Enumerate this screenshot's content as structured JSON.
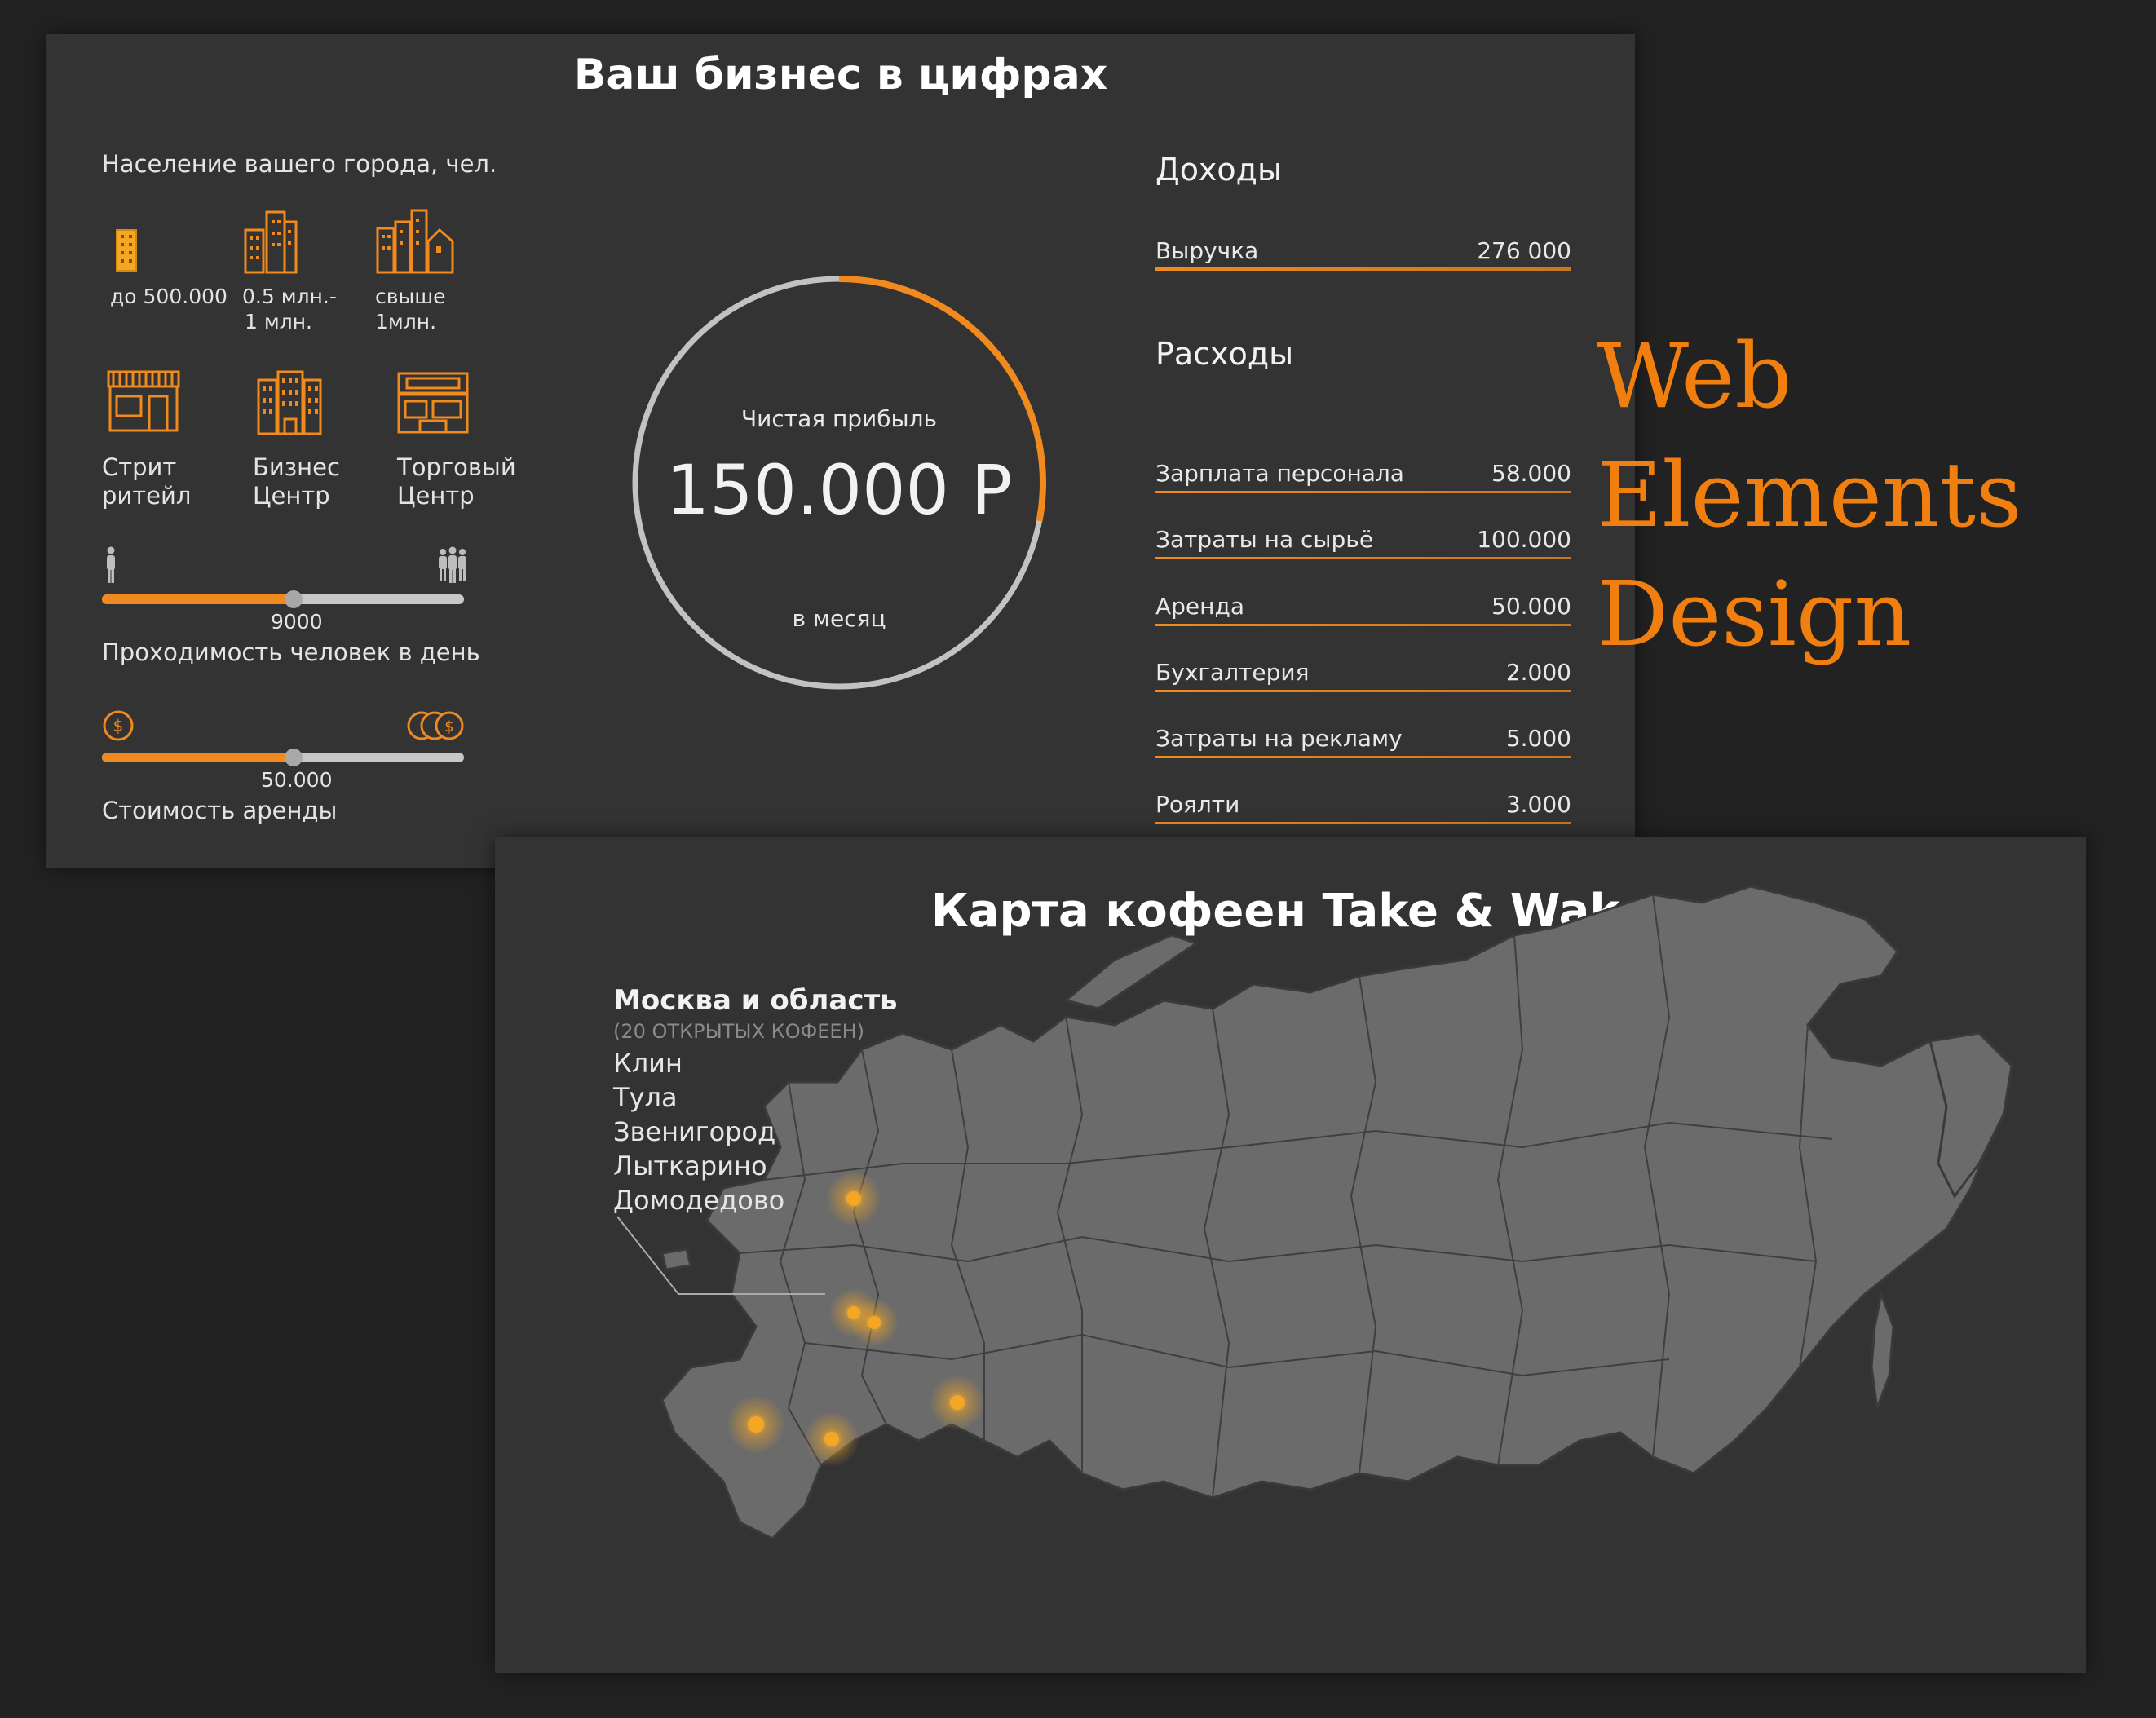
{
  "calculator": {
    "title": "Ваш бизнес в цифрах",
    "population_label": "Население вашего города, чел.",
    "population_options": [
      {
        "icon": "single-building-icon",
        "label_l1": "до 500.000",
        "label_l2": ""
      },
      {
        "icon": "buildings-icon",
        "label_l1": "0.5 млн.-",
        "label_l2": "1 млн."
      },
      {
        "icon": "city-icon",
        "label_l1": "свыше",
        "label_l2": "1млн."
      }
    ],
    "location_options": [
      {
        "icon": "storefront-icon",
        "label_l1": "Стрит",
        "label_l2": "ритейл"
      },
      {
        "icon": "office-building-icon",
        "label_l1": "Бизнес",
        "label_l2": "Центр"
      },
      {
        "icon": "mall-icon",
        "label_l1": "Торговый",
        "label_l2": "Центр"
      }
    ],
    "traffic": {
      "value": "9000",
      "label": "Проходимость человек  в день",
      "fraction": 0.53
    },
    "rent": {
      "value": "50.000",
      "label": "Стоимость аренды",
      "fraction": 0.53
    },
    "profit": {
      "caption": "Чистая прибыль",
      "amount": "150.000 Р",
      "period": "в месяц",
      "fraction": 0.28
    },
    "income": {
      "heading": "Доходы",
      "items": [
        {
          "name": "Выручка",
          "value": "276 000"
        }
      ]
    },
    "expenses": {
      "heading": "Расходы",
      "items": [
        {
          "name": "Зарплата персонала",
          "value": "58.000"
        },
        {
          "name": "Затраты на сырьё",
          "value": "100.000"
        },
        {
          "name": "Аренда",
          "value": "50.000"
        },
        {
          "name": "Бухгалтерия",
          "value": "2.000"
        },
        {
          "name": "Затраты на рекламу",
          "value": "5.000"
        },
        {
          "name": "Роялти",
          "value": "3.000"
        }
      ]
    },
    "colors": {
      "accent": "#f08a1e",
      "panel": "#333333",
      "track": "#c7c7c7"
    }
  },
  "overlay_text": {
    "line1": "Web",
    "line2": "Elements",
    "line3": "Design",
    "color": "#f07f10"
  },
  "map": {
    "title": "Карта кофеен Take & Wake",
    "region": "Москва и область",
    "count": "(20 ОТКРЫТЫХ КОФЕЕН)",
    "cities": [
      "Клин",
      "Тула",
      "Звенигород",
      "Лыткарино",
      "Домодедово"
    ],
    "marker_color": "#f5a623"
  }
}
